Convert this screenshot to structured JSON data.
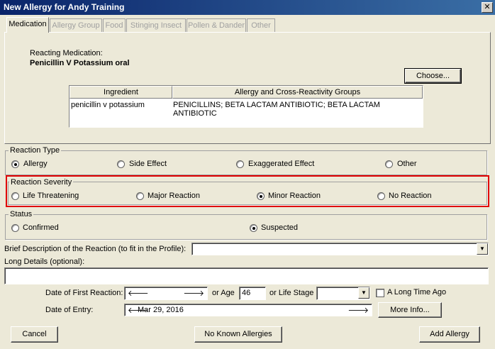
{
  "window": {
    "title": "New Allergy for Andy Training",
    "close_glyph": "✕"
  },
  "tabs": [
    "Medication",
    "Allergy Group",
    "Food",
    "Stinging Insect",
    "Pollen & Dander",
    "Other"
  ],
  "medication": {
    "reacting_label": "Reacting Medication:",
    "reacting_value": "Penicillin V Potassium oral",
    "choose_label": "Choose...",
    "grid": {
      "headers": [
        "Ingredient",
        "Allergy and Cross-Reactivity Groups"
      ],
      "rows": [
        [
          "penicillin v potassium",
          "PENICILLINS; BETA LACTAM ANTIBIOTIC; BETA LACTAM ANTIBIOTIC"
        ]
      ]
    }
  },
  "reaction_type": {
    "label": "Reaction Type",
    "options": [
      "Allergy",
      "Side Effect",
      "Exaggerated Effect",
      "Other"
    ],
    "selected": "Allergy"
  },
  "reaction_severity": {
    "label": "Reaction Severity",
    "options": [
      "Life Threatening",
      "Major Reaction",
      "Minor Reaction",
      "No Reaction"
    ],
    "selected": "Minor Reaction"
  },
  "status": {
    "label": "Status",
    "options": [
      "Confirmed",
      "Suspected"
    ],
    "selected": "Suspected"
  },
  "brief_description": {
    "label": "Brief Description of the Reaction (to fit in the Profile):",
    "value": ""
  },
  "long_details": {
    "label": "Long Details (optional):",
    "value": ""
  },
  "first_reaction": {
    "label": "Date of First Reaction:",
    "prev_glyph": "🡐",
    "next_glyph": "🡒",
    "or_age_label": "or Age",
    "age_value": "46",
    "life_stage_label": "or Life Stage",
    "life_stage_value": "",
    "long_time_label": "A Long Time Ago"
  },
  "entry": {
    "label": "Date of Entry:",
    "value": "Mar 29, 2016",
    "more_info_label": "More Info..."
  },
  "footer": {
    "cancel_label": "Cancel",
    "no_known_label": "No Known Allergies",
    "add_label": "Add Allergy"
  },
  "colors": {
    "title_bar": "#0a246a",
    "highlight": "#e00000"
  }
}
